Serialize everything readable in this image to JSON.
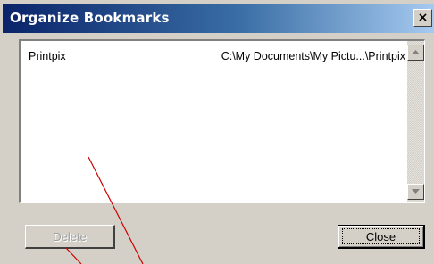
{
  "window": {
    "title": "Organize Bookmarks",
    "close_glyph": "×"
  },
  "bookmarks": [
    {
      "name": "Printpix",
      "path": "C:\\My Documents\\My Pictu...\\Printpix"
    }
  ],
  "buttons": {
    "delete_label": "Delete",
    "delete_enabled": false,
    "close_label": "Close"
  },
  "icons": {
    "scroll_up": "scroll-up-arrow-icon",
    "scroll_down": "scroll-down-arrow-icon"
  },
  "colors": {
    "annotation_line": "#cc0000"
  }
}
